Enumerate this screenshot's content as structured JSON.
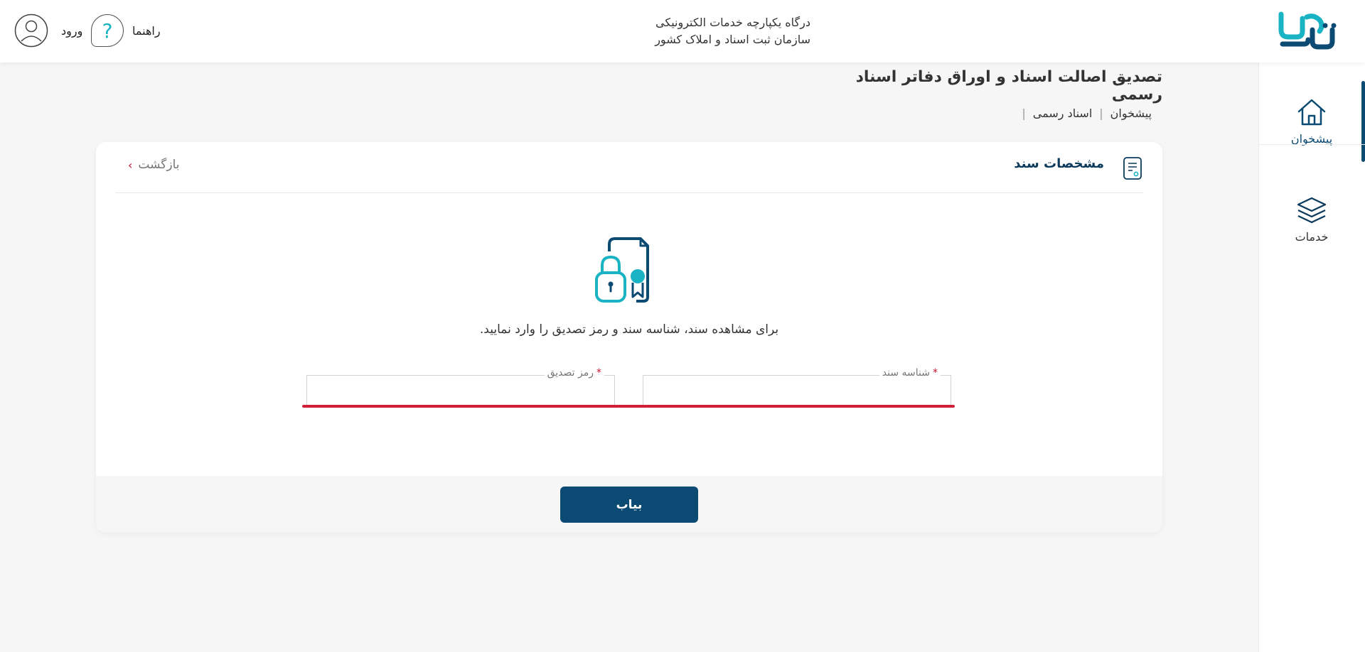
{
  "header": {
    "title_line1": "درگاه یکپارچه خدمات الکترونیکی",
    "title_line2": "سازمان ثبت اسناد و املاک کشور",
    "help_label": "راهنما",
    "help_symbol": "?",
    "login_label": "ورود",
    "logo_icon": "sabt-logo-icon",
    "accent_color": "#19b3c4",
    "brand_color": "#0b4a72"
  },
  "sidebar": {
    "items": [
      {
        "label": "پیشخوان",
        "icon": "home-icon",
        "active": true
      },
      {
        "label": "خدمات",
        "icon": "layers-icon",
        "active": false
      }
    ]
  },
  "page": {
    "title": "تصدیق اصالت اسناد و اوراق دفاتر اسناد رسمی",
    "breadcrumb": [
      "پیشخوان",
      "اسناد رسمی"
    ]
  },
  "card": {
    "title": "مشخصات سند",
    "back_label": "بازگشت",
    "instruction": "برای مشاهده سند، شناسه سند و رمز تصدیق را وارد نمایید.",
    "fields": {
      "doc_id": {
        "label": "شناسه سند",
        "value": "",
        "required": true
      },
      "verify_code": {
        "label": "رمز تصدیق",
        "value": "",
        "required": true
      }
    },
    "required_mark": "*",
    "error_color": "#d11f35",
    "submit_label": "بیاب"
  }
}
